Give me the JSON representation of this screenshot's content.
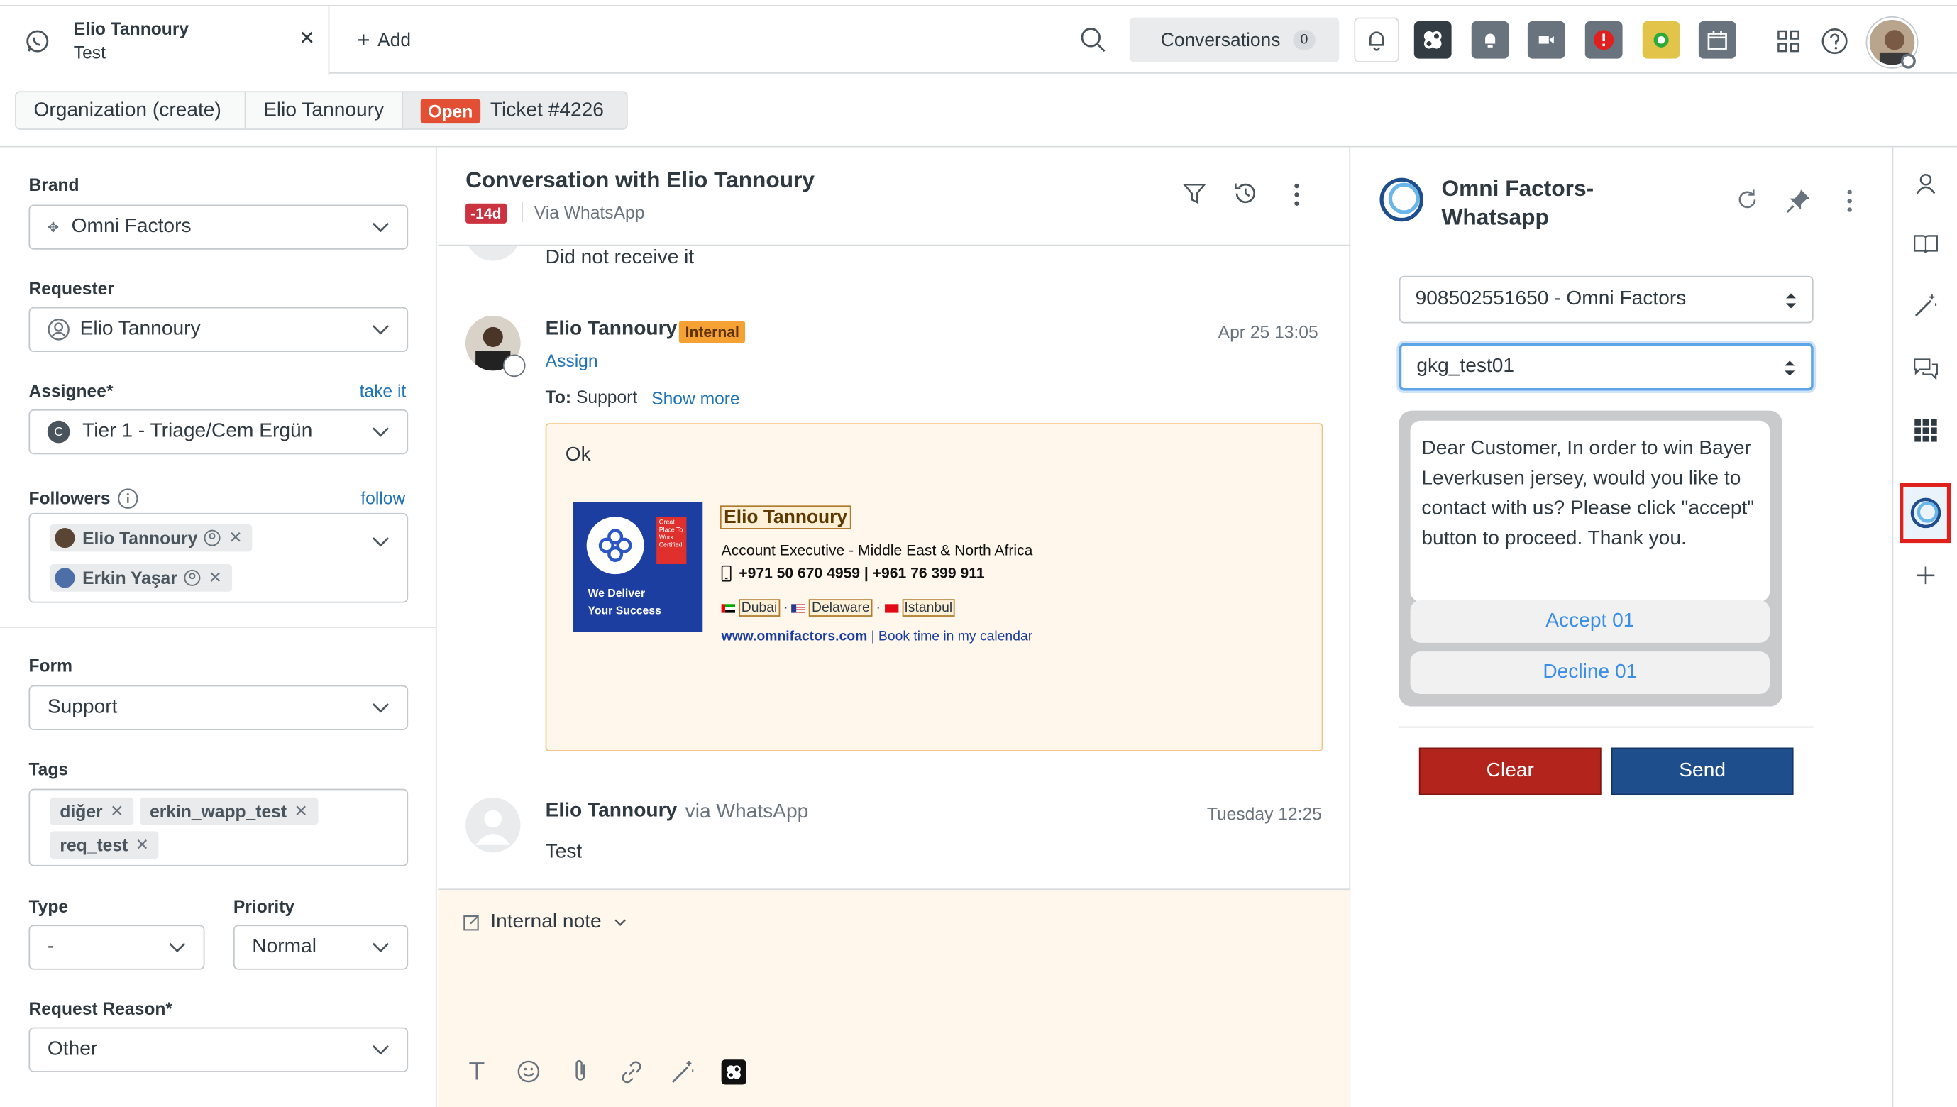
{
  "topbar": {
    "tab_name": "Elio Tannoury",
    "tab_sub": "Test",
    "add_label": "Add",
    "conversations_label": "Conversations",
    "conversations_count": "0"
  },
  "subnav": {
    "crumbs": [
      "Organization (create)",
      "Elio Tannoury"
    ],
    "status_badge": "Open",
    "ticket": "Ticket #4226"
  },
  "left": {
    "brand_label": "Brand",
    "brand_value": "Omni Factors",
    "requester_label": "Requester",
    "requester_value": "Elio Tannoury",
    "assignee_label": "Assignee*",
    "take_it": "take it",
    "assignee_avatar": "C",
    "assignee_value": "Tier 1 - Triage/Cem Ergün",
    "followers_label": "Followers",
    "follow_link": "follow",
    "followers": [
      "Elio Tannoury",
      "Erkin Yaşar"
    ],
    "form_label": "Form",
    "form_value": "Support",
    "tags_label": "Tags",
    "tags": [
      "diğer",
      "erkin_wapp_test",
      "req_test"
    ],
    "type_label": "Type",
    "type_value": "-",
    "priority_label": "Priority",
    "priority_value": "Normal",
    "reason_label": "Request Reason*",
    "reason_value": "Other"
  },
  "conversation": {
    "title": "Conversation with Elio Tannoury",
    "age_badge": "-14d",
    "via": "Via WhatsApp",
    "prev_text": "Did not receive it",
    "msg1": {
      "author": "Elio Tannoury",
      "badge": "Internal",
      "time": "Apr 25 13:05",
      "assign": "Assign",
      "to_label": "To:",
      "to_value": "Support",
      "show_more": "Show more",
      "body": "Ok",
      "sig_name": "Elio Tannoury",
      "sig_role": "Account Executive - Middle East & North Africa",
      "sig_phone": "+971 50 670 4959 | +961 76 399 911",
      "sig_cities": [
        "Dubai",
        "Delaware",
        "Istanbul"
      ],
      "sig_site": "www.omnifactors.com",
      "sig_sep": "|",
      "sig_book": "Book time in my calendar",
      "logo_line1": "We Deliver",
      "logo_line2": "Your Success",
      "logo_badge": "Great Place To Work Certified"
    },
    "msg2": {
      "author": "Elio Tannoury",
      "via": "via WhatsApp",
      "time": "Tuesday 12:25",
      "body": "Test"
    },
    "composer_mode": "Internal note"
  },
  "app": {
    "title_line1": "Omni Factors-",
    "title_line2": "Whatsapp",
    "number_select": "908502551650 - Omni Factors",
    "template_select": "gkg_test01",
    "template_body": "Dear Customer, In order to win Bayer Leverkusen jersey, would you like to contact with us? Please click \"accept\" button to proceed. Thank you.",
    "accept": "Accept 01",
    "decline": "Decline 01",
    "clear": "Clear",
    "send": "Send"
  },
  "colors": {
    "accent": "#1f73b7",
    "open_badge": "#e34f32",
    "age_badge": "#cc3340",
    "internal_badge": "#f5a133",
    "clear": "#b3251c",
    "send": "#1f4e8c",
    "composer_bg": "#fff6ec"
  }
}
